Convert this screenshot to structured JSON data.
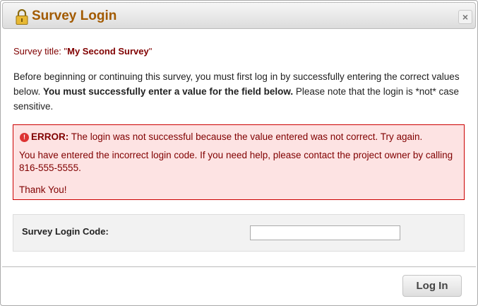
{
  "dialog": {
    "title": "Survey Login",
    "title_icon": "lock-icon",
    "close_label": "×"
  },
  "survey": {
    "label": "Survey title: \"",
    "name": "My Second Survey",
    "label_end": "\""
  },
  "intro": {
    "text1": "Before beginning or continuing this survey, you must first log in by successfully entering the correct values below. ",
    "bold": "You must successfully enter a value for the field below.",
    "text2": " Please note that the login is *not* case sensitive."
  },
  "error": {
    "icon": "error-icon",
    "icon_glyph": "!",
    "heading": "ERROR:",
    "message": " The login was not successful because the value entered was not correct. Try again.",
    "details": "You have entered the incorrect login code. If you need help, please contact the project owner by calling 816-555-5555.",
    "closing": "Thank You!",
    "accent_color": "#cc0000",
    "background_color": "#fde3e3"
  },
  "login": {
    "field_label": "Survey Login Code:",
    "field_value": "",
    "button_label": "Log In"
  }
}
